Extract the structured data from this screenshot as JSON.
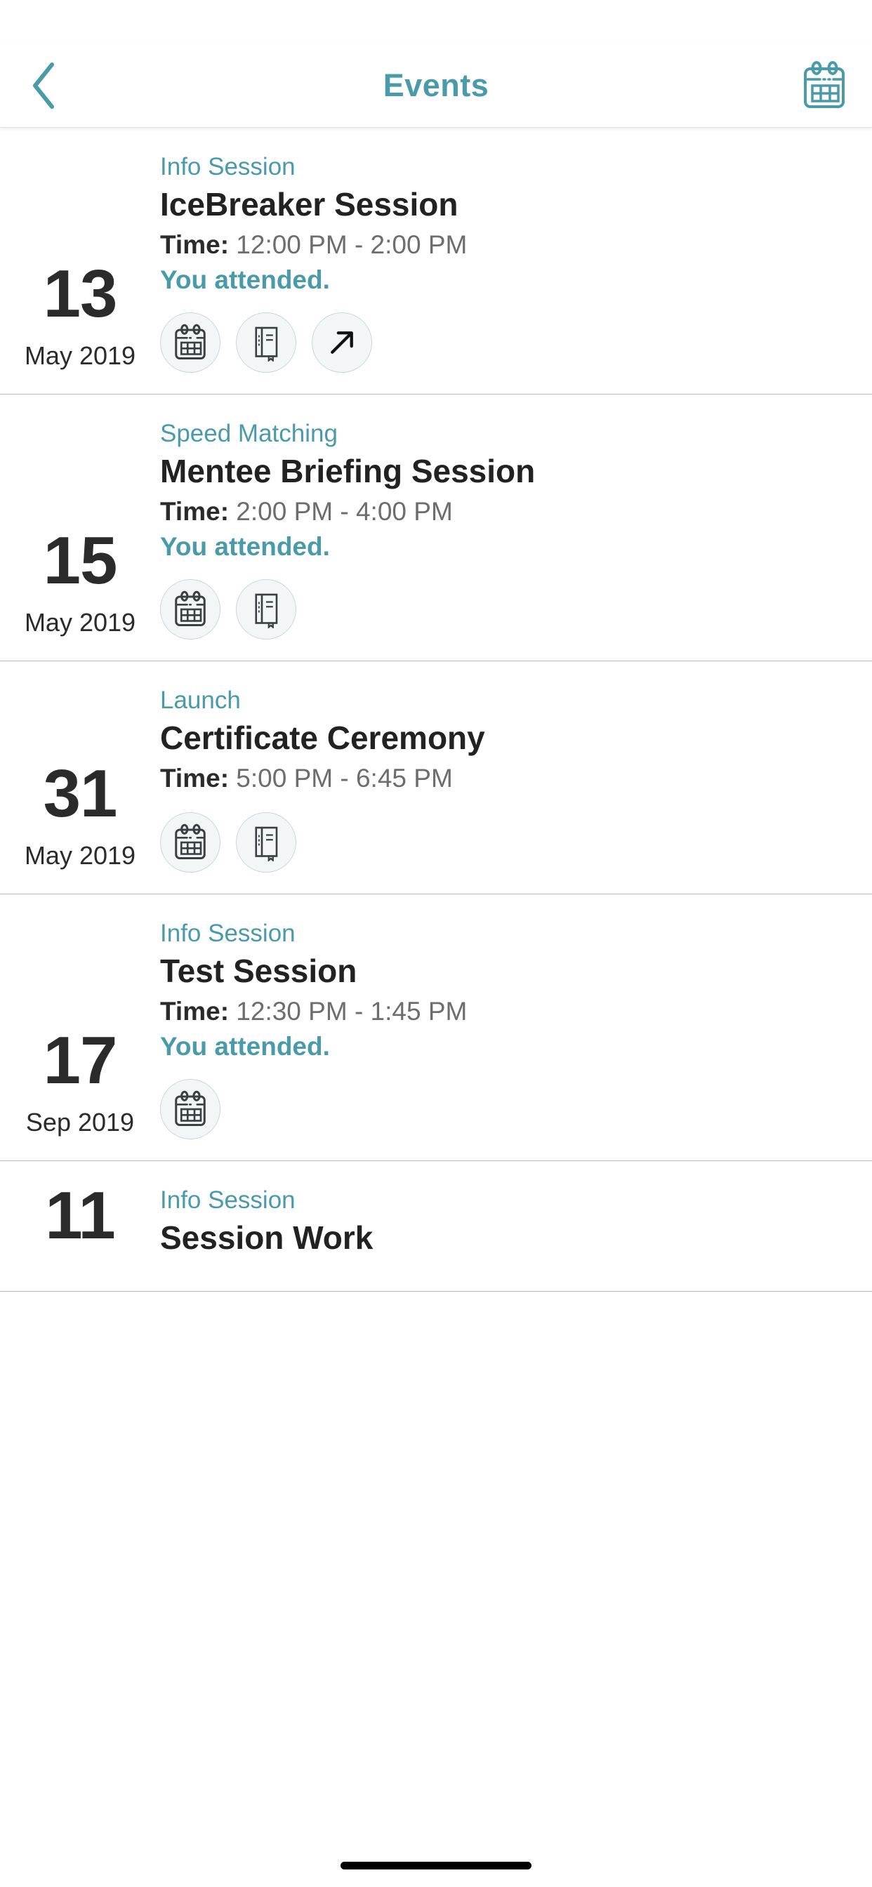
{
  "header": {
    "title": "Events",
    "back_icon": "chevron-left-icon",
    "calendar_icon": "calendar-icon",
    "accent_color": "#4A9BAA"
  },
  "colors": {
    "accent": "#4A9BAA",
    "title_text": "#222222",
    "time_text": "#6d6d6d",
    "date_text": "#2b2b2b",
    "divider": "#b9b9b9",
    "action_fill": "#f2f6f7",
    "action_border": "#cfd6d8"
  },
  "time_label": "Time:",
  "events": [
    {
      "day": "13",
      "month_year": "May 2019",
      "category": "Info Session",
      "title": "IceBreaker Session",
      "time_range": "12:00 PM - 2:00 PM",
      "attended": "You attended.",
      "actions": [
        "calendar-icon",
        "notebook-icon",
        "external-link-icon"
      ]
    },
    {
      "day": "15",
      "month_year": "May 2019",
      "category": "Speed Matching",
      "title": "Mentee Briefing Session",
      "time_range": "2:00 PM - 4:00 PM",
      "attended": "You attended.",
      "actions": [
        "calendar-icon",
        "notebook-icon"
      ]
    },
    {
      "day": "31",
      "month_year": "May 2019",
      "category": "Launch",
      "title": "Certificate Ceremony",
      "time_range": "5:00 PM - 6:45 PM",
      "attended": "",
      "actions": [
        "calendar-icon",
        "notebook-icon"
      ]
    },
    {
      "day": "17",
      "month_year": "Sep 2019",
      "category": "Info Session",
      "title": "Test Session",
      "time_range": "12:30 PM - 1:45 PM",
      "attended": "You attended.",
      "actions": [
        "calendar-icon"
      ]
    },
    {
      "day": "11",
      "month_year": "",
      "category": "Info Session",
      "title": "Session Work",
      "time_range": "",
      "attended": "",
      "actions": []
    }
  ]
}
